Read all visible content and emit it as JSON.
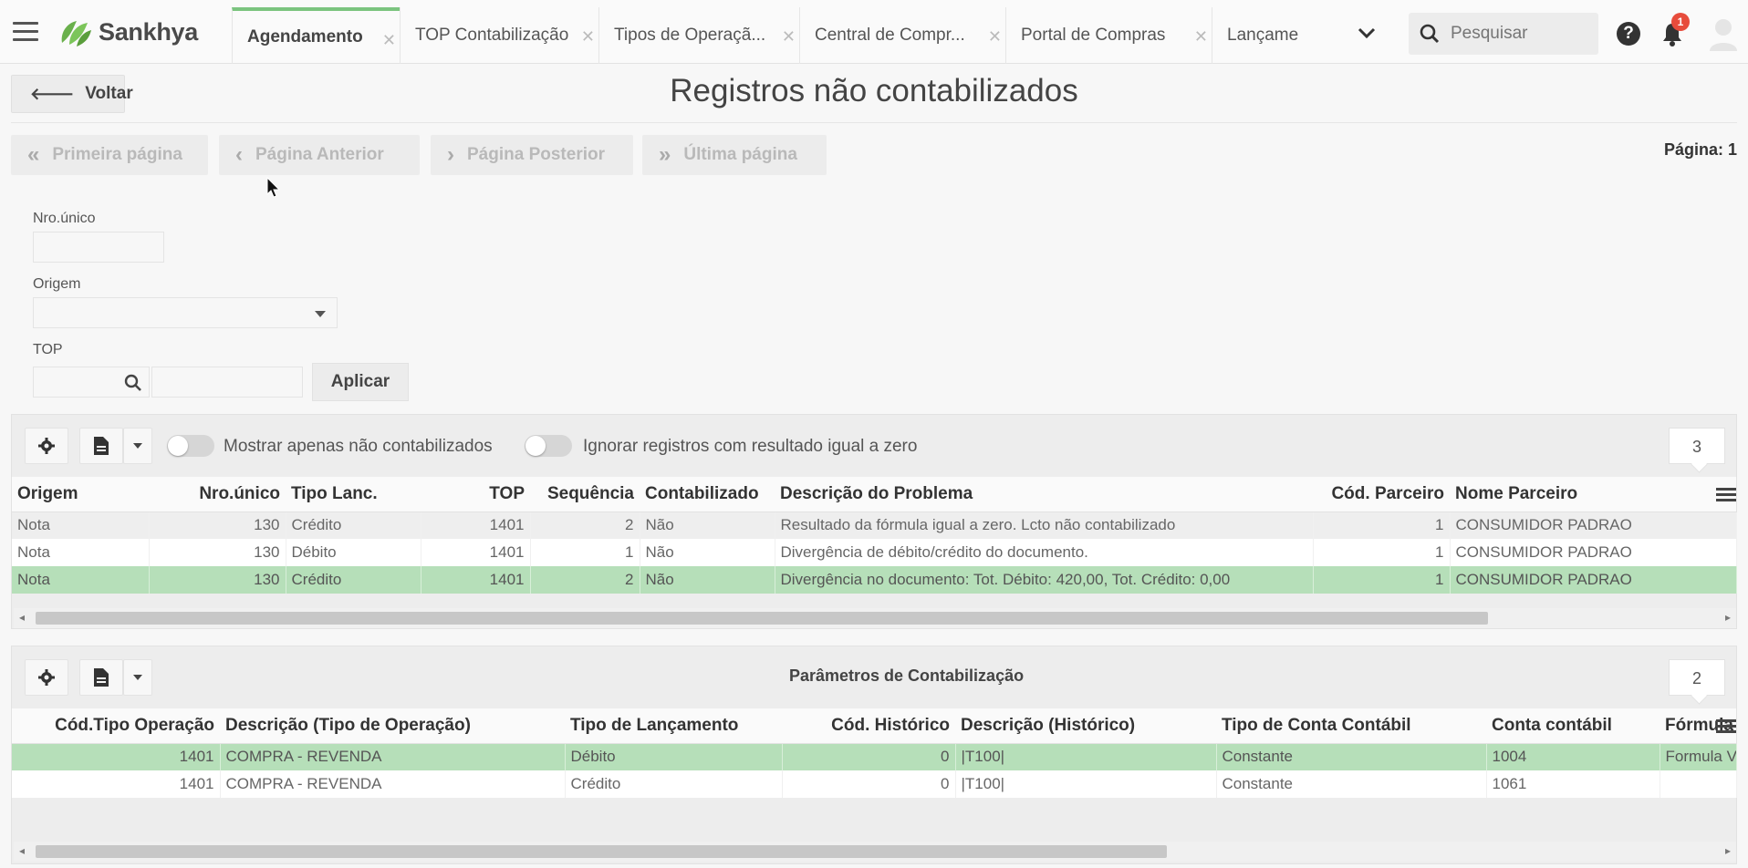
{
  "app": {
    "brand": "Sankhya"
  },
  "tabs": [
    {
      "label": "Agendamento",
      "active": true
    },
    {
      "label": "TOP Contabilização"
    },
    {
      "label": "Tipos de Operaçã..."
    },
    {
      "label": "Central de Compr..."
    },
    {
      "label": "Portal de Compras"
    },
    {
      "label": "Lançame"
    }
  ],
  "search": {
    "placeholder": "Pesquisar"
  },
  "notifications": {
    "count": "1"
  },
  "header": {
    "back_label": "Voltar",
    "title": "Registros não contabilizados"
  },
  "pagination": {
    "first": "Primeira página",
    "prev": "Página Anterior",
    "next": "Página Posterior",
    "last": "Última página",
    "page_label": "Página: 1"
  },
  "filters": {
    "nro_unico_label": "Nro.único",
    "nro_unico_value": "",
    "origem_label": "Origem",
    "origem_value": "",
    "top_label": "TOP",
    "top_code": "",
    "top_desc": "",
    "apply_label": "Aplicar"
  },
  "grid1": {
    "toggle1_label": "Mostrar apenas não contabilizados",
    "toggle1_on": false,
    "toggle2_label": "Ignorar registros com resultado igual a zero",
    "toggle2_on": false,
    "count": "3",
    "columns": [
      "Origem",
      "Nro.único",
      "Tipo Lanc.",
      "TOP",
      "Sequência",
      "Contabilizado",
      "Descrição do Problema",
      "Cód. Parceiro",
      "Nome Parceiro"
    ],
    "rows": [
      [
        "Nota",
        "130",
        "Crédito",
        "1401",
        "2",
        "Não",
        "Resultado da fórmula igual a zero. Lcto não contabilizado",
        "1",
        "CONSUMIDOR PADRAO"
      ],
      [
        "Nota",
        "130",
        "Débito",
        "1401",
        "1",
        "Não",
        "Divergência de débito/crédito do documento.",
        "1",
        "CONSUMIDOR PADRAO"
      ],
      [
        "Nota",
        "130",
        "Crédito",
        "1401",
        "2",
        "Não",
        "Divergência no documento: Tot. Débito: 420,00, Tot. Crédito: 0,00",
        "1",
        "CONSUMIDOR PADRAO"
      ]
    ]
  },
  "grid2": {
    "title": "Parâmetros de Contabilização",
    "count": "2",
    "columns": [
      "Cód.Tipo Operação",
      "Descrição (Tipo de Operação)",
      "Tipo de Lançamento",
      "Cód. Histórico",
      "Descrição (Histórico)",
      "Tipo de Conta Contábil",
      "Conta contábil",
      "Fórmula"
    ],
    "rows": [
      [
        "1401",
        "COMPRA - REVENDA",
        "Débito",
        "0",
        "|T100|",
        "Constante",
        "1004",
        "Formula V"
      ],
      [
        "1401",
        "COMPRA - REVENDA",
        "Crédito",
        "0",
        "|T100|",
        "Constante",
        "1061",
        ""
      ]
    ]
  }
}
